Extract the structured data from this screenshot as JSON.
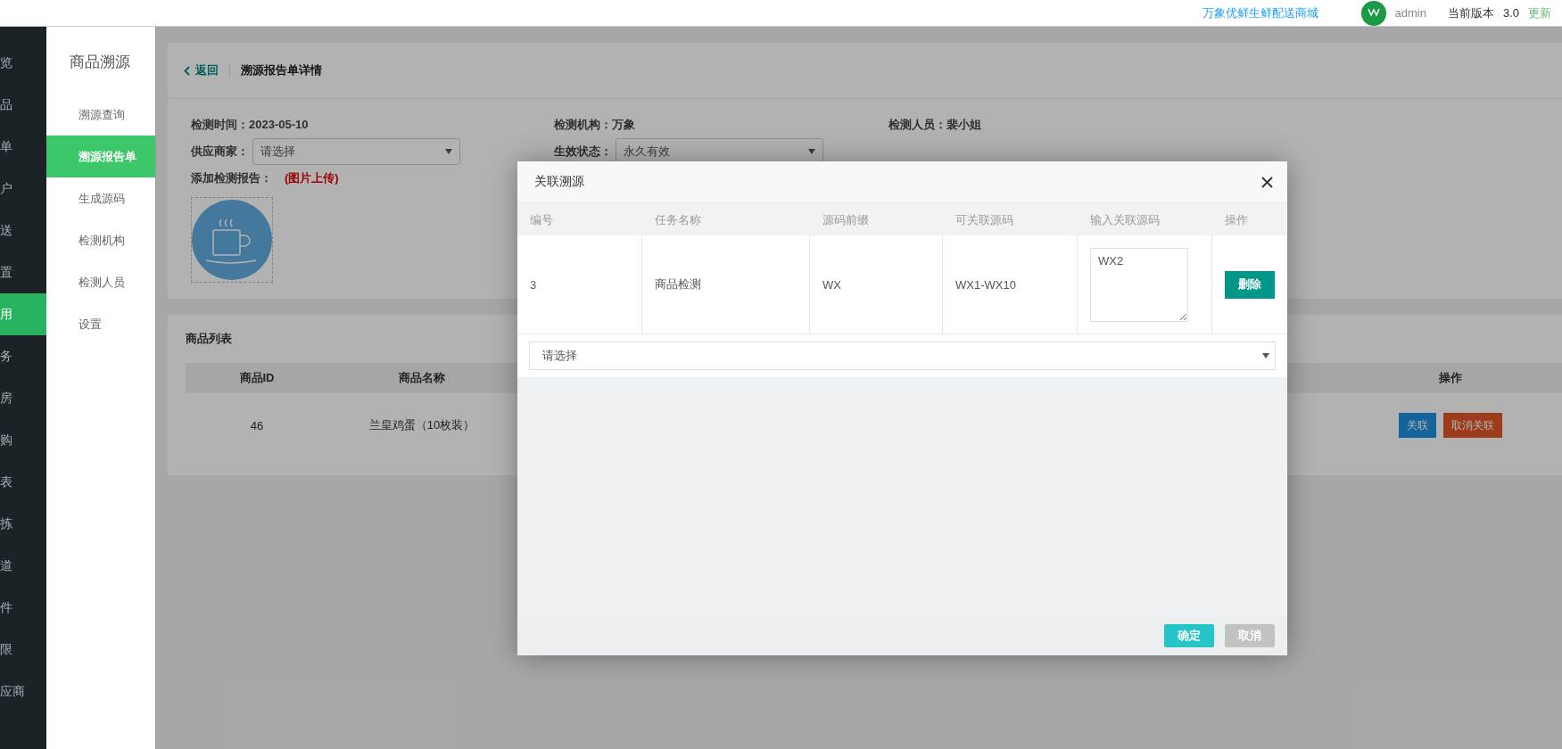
{
  "topbar": {
    "shop_link": "万象优鲜生鲜配送商城",
    "user": "admin",
    "version_label": "当前版本",
    "version": "3.0",
    "update_link": "更新"
  },
  "main_nav": [
    {
      "label": "览",
      "selected": false
    },
    {
      "label": "品",
      "selected": false
    },
    {
      "label": "单",
      "selected": false
    },
    {
      "label": "户",
      "selected": false
    },
    {
      "label": "送",
      "selected": false
    },
    {
      "label": "置",
      "selected": false
    },
    {
      "label": "用",
      "selected": true
    },
    {
      "label": "务",
      "selected": false
    },
    {
      "label": "房",
      "selected": false
    },
    {
      "label": "购",
      "selected": false
    },
    {
      "label": "表",
      "selected": false
    },
    {
      "label": "拣",
      "selected": false
    },
    {
      "label": "道",
      "selected": false
    },
    {
      "label": "件",
      "selected": false
    },
    {
      "label": "限",
      "selected": false
    },
    {
      "label": "应商",
      "selected": false
    }
  ],
  "sub_nav": {
    "title": "商品溯源",
    "items": [
      {
        "label": "溯源查询",
        "selected": false
      },
      {
        "label": "溯源报告单",
        "selected": true
      },
      {
        "label": "生成源码",
        "selected": false
      },
      {
        "label": "检测机构",
        "selected": false
      },
      {
        "label": "检测人员",
        "selected": false
      },
      {
        "label": "设置",
        "selected": false
      }
    ]
  },
  "report": {
    "back": "返回",
    "title": "溯源报告单详情",
    "info": [
      {
        "label": "检测时间：",
        "value": "2023-05-10"
      },
      {
        "label": "检测机构：",
        "value": "万象"
      },
      {
        "label": "检测人员：",
        "value": "裴小姐"
      }
    ],
    "selects": [
      {
        "label": "供应商家：",
        "value": "请选择"
      },
      {
        "label": "生效状态：",
        "value": "永久有效"
      }
    ],
    "upload_label": "添加检测报告：",
    "upload_hint": "(图片上传)"
  },
  "products": {
    "title": "商品列表",
    "columns": [
      "商品ID",
      "商品名称",
      "操作"
    ],
    "rows": [
      {
        "id": "46",
        "name": "兰皇鸡蛋（10枚装）",
        "actions": [
          {
            "label": "关联",
            "kind": "link"
          },
          {
            "label": "取消关联",
            "kind": "unlink"
          }
        ]
      }
    ]
  },
  "dialog": {
    "title": "关联溯源",
    "columns": [
      "编号",
      "任务名称",
      "源码前缀",
      "可关联源码",
      "输入关联源码",
      "操作"
    ],
    "rows": [
      {
        "no": "3",
        "task": "商品检测",
        "prefix": "WX",
        "range": "WX1-WX10",
        "code": "WX2",
        "action": "删除"
      }
    ],
    "select": "请选择",
    "buttons": [
      {
        "label": "确定",
        "kind": "confirm"
      },
      {
        "label": "取消",
        "kind": "cancel"
      }
    ]
  }
}
